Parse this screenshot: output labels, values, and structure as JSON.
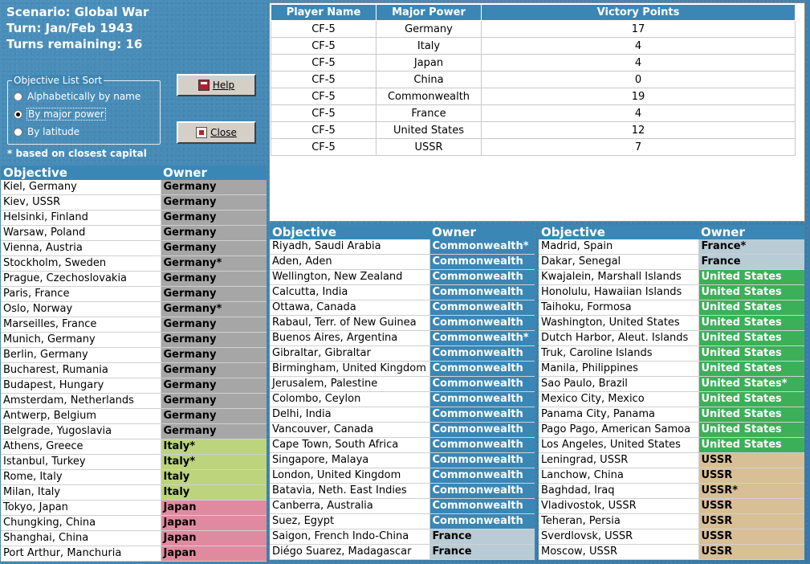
{
  "scenario": {
    "name": "Scenario: Global War",
    "turn": "Turn: Jan/Feb 1943",
    "turns_remaining": "Turns remaining: 16"
  },
  "sort": {
    "legend": "Objective List Sort",
    "options": [
      {
        "label": "Alphabetically by name",
        "selected": false
      },
      {
        "label": "By major power",
        "selected": true
      },
      {
        "label": "By latitude",
        "selected": false
      }
    ],
    "note": "* based on closest capital"
  },
  "buttons": {
    "help": "Help",
    "close": "Close"
  },
  "owner_colors": {
    "Germany": {
      "bg": "#a6a6a6",
      "fg": "#000000"
    },
    "Italy": {
      "bg": "#bcd47c",
      "fg": "#000000"
    },
    "Japan": {
      "bg": "#e08aa0",
      "fg": "#000000"
    },
    "Commonwealth": {
      "bg": "#3a87b5",
      "fg": "#ffffff"
    },
    "France": {
      "bg": "#b8ccd6",
      "fg": "#000000"
    },
    "United States": {
      "bg": "#3cb059",
      "fg": "#ffffff"
    },
    "USSR": {
      "bg": "#d8bf96",
      "fg": "#000000"
    }
  },
  "victory_table": {
    "headers": [
      "Player Name",
      "Major Power",
      "Victory Points"
    ],
    "rows": [
      [
        "CF-5",
        "Germany",
        "17"
      ],
      [
        "CF-5",
        "Italy",
        "4"
      ],
      [
        "CF-5",
        "Japan",
        "4"
      ],
      [
        "CF-5",
        "China",
        "0"
      ],
      [
        "CF-5",
        "Commonwealth",
        "19"
      ],
      [
        "CF-5",
        "France",
        "4"
      ],
      [
        "CF-5",
        "United States",
        "12"
      ],
      [
        "CF-5",
        "USSR",
        "7"
      ]
    ]
  },
  "objective_headers": {
    "objective": "Objective",
    "owner": "Owner"
  },
  "objectives_col1": [
    {
      "name": "Kiel, Germany",
      "owner": "Germany"
    },
    {
      "name": "Kiev, USSR",
      "owner": "Germany"
    },
    {
      "name": "Helsinki, Finland",
      "owner": "Germany"
    },
    {
      "name": "Warsaw, Poland",
      "owner": "Germany"
    },
    {
      "name": "Vienna, Austria",
      "owner": "Germany"
    },
    {
      "name": "Stockholm, Sweden",
      "owner": "Germany*"
    },
    {
      "name": "Prague, Czechoslovakia",
      "owner": "Germany"
    },
    {
      "name": "Paris, France",
      "owner": "Germany"
    },
    {
      "name": "Oslo, Norway",
      "owner": "Germany*"
    },
    {
      "name": "Marseilles, France",
      "owner": "Germany"
    },
    {
      "name": "Munich, Germany",
      "owner": "Germany"
    },
    {
      "name": "Berlin, Germany",
      "owner": "Germany"
    },
    {
      "name": "Bucharest, Rumania",
      "owner": "Germany"
    },
    {
      "name": "Budapest, Hungary",
      "owner": "Germany"
    },
    {
      "name": "Amsterdam, Netherlands",
      "owner": "Germany"
    },
    {
      "name": "Antwerp, Belgium",
      "owner": "Germany"
    },
    {
      "name": "Belgrade, Yugoslavia",
      "owner": "Germany"
    },
    {
      "name": "Athens, Greece",
      "owner": "Italy*"
    },
    {
      "name": "Istanbul, Turkey",
      "owner": "Italy*"
    },
    {
      "name": "Rome, Italy",
      "owner": "Italy"
    },
    {
      "name": "Milan, Italy",
      "owner": "Italy"
    },
    {
      "name": "Tokyo, Japan",
      "owner": "Japan"
    },
    {
      "name": "Chungking, China",
      "owner": "Japan"
    },
    {
      "name": "Shanghai, China",
      "owner": "Japan"
    },
    {
      "name": "Port Arthur, Manchuria",
      "owner": "Japan"
    }
  ],
  "objectives_col2": [
    {
      "name": "Riyadh, Saudi Arabia",
      "owner": "Commonwealth*"
    },
    {
      "name": "Aden, Aden",
      "owner": "Commonwealth"
    },
    {
      "name": "Wellington, New Zealand",
      "owner": "Commonwealth"
    },
    {
      "name": "Calcutta, India",
      "owner": "Commonwealth"
    },
    {
      "name": "Ottawa, Canada",
      "owner": "Commonwealth"
    },
    {
      "name": "Rabaul, Terr. of New Guinea",
      "owner": "Commonwealth"
    },
    {
      "name": "Buenos Aires, Argentina",
      "owner": "Commonwealth*"
    },
    {
      "name": "Gibraltar, Gibraltar",
      "owner": "Commonwealth"
    },
    {
      "name": "Birmingham, United Kingdom",
      "owner": "Commonwealth"
    },
    {
      "name": "Jerusalem, Palestine",
      "owner": "Commonwealth"
    },
    {
      "name": "Colombo, Ceylon",
      "owner": "Commonwealth"
    },
    {
      "name": "Delhi, India",
      "owner": "Commonwealth"
    },
    {
      "name": "Vancouver, Canada",
      "owner": "Commonwealth"
    },
    {
      "name": "Cape Town, South Africa",
      "owner": "Commonwealth"
    },
    {
      "name": "Singapore, Malaya",
      "owner": "Commonwealth"
    },
    {
      "name": "London, United Kingdom",
      "owner": "Commonwealth"
    },
    {
      "name": "Batavia, Neth. East Indies",
      "owner": "Commonwealth"
    },
    {
      "name": "Canberra, Australia",
      "owner": "Commonwealth"
    },
    {
      "name": "Suez, Egypt",
      "owner": "Commonwealth"
    },
    {
      "name": "Saigon, French Indo-China",
      "owner": "France"
    },
    {
      "name": "Diégo Suarez, Madagascar",
      "owner": "France"
    }
  ],
  "objectives_col3": [
    {
      "name": "Madrid, Spain",
      "owner": "France*"
    },
    {
      "name": "Dakar, Senegal",
      "owner": "France"
    },
    {
      "name": "Kwajalein, Marshall Islands",
      "owner": "United States"
    },
    {
      "name": "Honolulu, Hawaiian Islands",
      "owner": "United States"
    },
    {
      "name": "Taihoku, Formosa",
      "owner": "United States"
    },
    {
      "name": "Washington, United States",
      "owner": "United States"
    },
    {
      "name": "Dutch Harbor, Aleut. Islands",
      "owner": "United States"
    },
    {
      "name": "Truk, Caroline Islands",
      "owner": "United States"
    },
    {
      "name": "Manila, Philippines",
      "owner": "United States"
    },
    {
      "name": "Sao Paulo, Brazil",
      "owner": "United States*"
    },
    {
      "name": "Mexico City, Mexico",
      "owner": "United States"
    },
    {
      "name": "Panama City, Panama",
      "owner": "United States"
    },
    {
      "name": "Pago Pago, American Samoa",
      "owner": "United States"
    },
    {
      "name": "Los Angeles, United States",
      "owner": "United States"
    },
    {
      "name": "Leningrad, USSR",
      "owner": "USSR"
    },
    {
      "name": "Lanchow, China",
      "owner": "USSR"
    },
    {
      "name": "Baghdad, Iraq",
      "owner": "USSR*"
    },
    {
      "name": "Vladivostok, USSR",
      "owner": "USSR"
    },
    {
      "name": "Teheran, Persia",
      "owner": "USSR"
    },
    {
      "name": "Sverdlovsk, USSR",
      "owner": "USSR"
    },
    {
      "name": "Moscow, USSR",
      "owner": "USSR"
    }
  ]
}
